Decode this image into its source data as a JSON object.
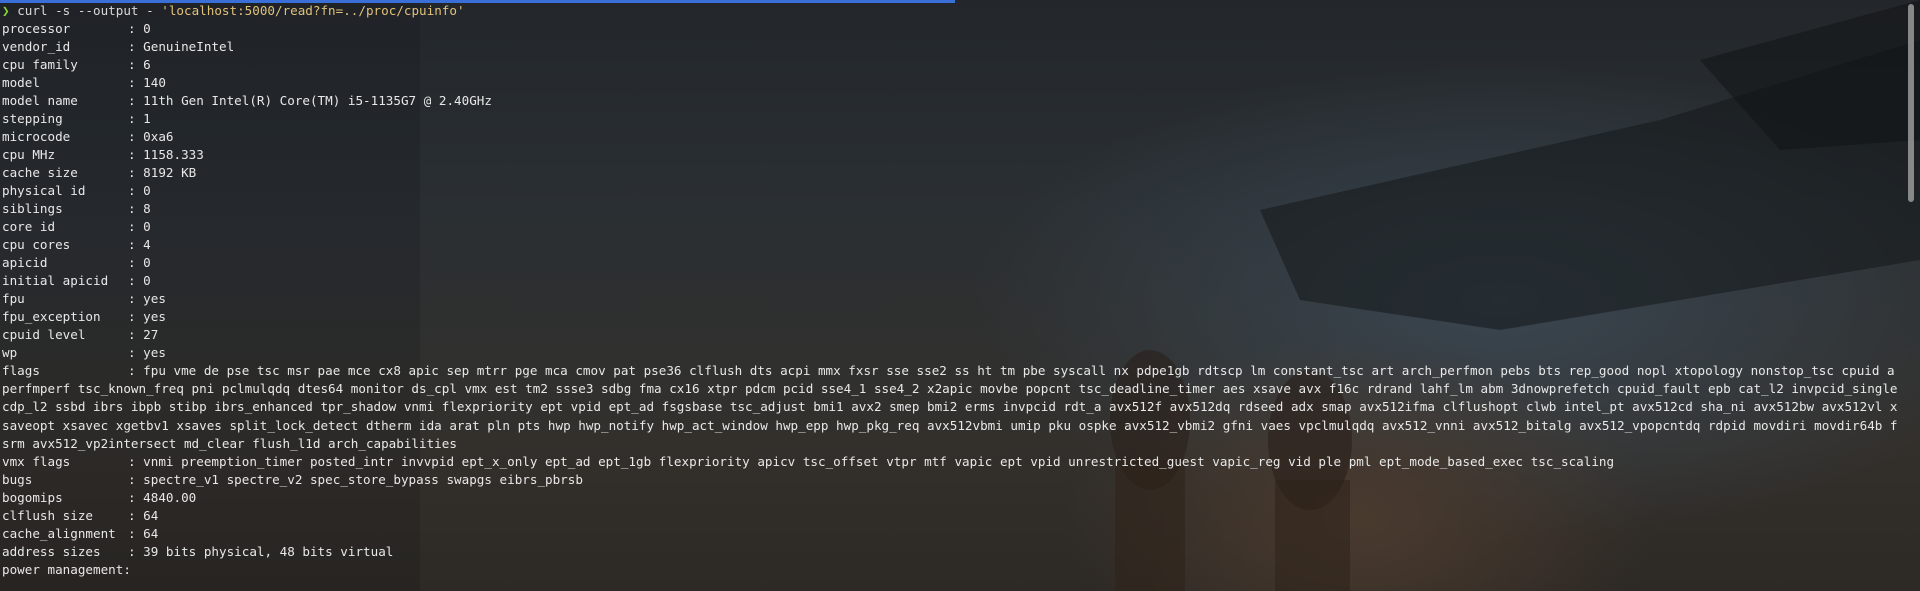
{
  "terminal": {
    "prompt_symbol": "❯",
    "command_prefix": "curl -s --output - ",
    "command_arg": "'localhost:5000/read?fn=../proc/cpuinfo'"
  },
  "cpuinfo": [
    {
      "key": "processor",
      "value": "0"
    },
    {
      "key": "vendor_id",
      "value": "GenuineIntel"
    },
    {
      "key": "cpu family",
      "value": "6"
    },
    {
      "key": "model",
      "value": "140"
    },
    {
      "key": "model name",
      "value": "11th Gen Intel(R) Core(TM) i5-1135G7 @ 2.40GHz"
    },
    {
      "key": "stepping",
      "value": "1"
    },
    {
      "key": "microcode",
      "value": "0xa6"
    },
    {
      "key": "cpu MHz",
      "value": "1158.333"
    },
    {
      "key": "cache size",
      "value": "8192 KB"
    },
    {
      "key": "physical id",
      "value": "0"
    },
    {
      "key": "siblings",
      "value": "8"
    },
    {
      "key": "core id",
      "value": "0"
    },
    {
      "key": "cpu cores",
      "value": "4"
    },
    {
      "key": "apicid",
      "value": "0"
    },
    {
      "key": "initial apicid",
      "value": "0"
    },
    {
      "key": "fpu",
      "value": "yes"
    },
    {
      "key": "fpu_exception",
      "value": "yes"
    },
    {
      "key": "cpuid level",
      "value": "27"
    },
    {
      "key": "wp",
      "value": "yes"
    }
  ],
  "flags": {
    "key": "flags",
    "value": "fpu vme de pse tsc msr pae mce cx8 apic sep mtrr pge mca cmov pat pse36 clflush dts acpi mmx fxsr sse sse2 ss ht tm pbe syscall nx pdpe1gb rdtscp lm constant_tsc art arch_perfmon pebs bts rep_good nopl xtopology nonstop_tsc cpuid aperfmperf tsc_known_freq pni pclmulqdq dtes64 monitor ds_cpl vmx est tm2 ssse3 sdbg fma cx16 xtpr pdcm pcid sse4_1 sse4_2 x2apic movbe popcnt tsc_deadline_timer aes xsave avx f16c rdrand lahf_lm abm 3dnowprefetch cpuid_fault epb cat_l2 invpcid_single cdp_l2 ssbd ibrs ibpb stibp ibrs_enhanced tpr_shadow vnmi flexpriority ept vpid ept_ad fsgsbase tsc_adjust bmi1 avx2 smep bmi2 erms invpcid rdt_a avx512f avx512dq rdseed adx smap avx512ifma clflushopt clwb intel_pt avx512cd sha_ni avx512bw avx512vl xsaveopt xsavec xgetbv1 xsaves split_lock_detect dtherm ida arat pln pts hwp hwp_notify hwp_act_window hwp_epp hwp_pkg_req avx512vbmi umip pku ospke avx512_vbmi2 gfni vaes vpclmulqdq avx512_vnni avx512_bitalg avx512_vpopcntdq rdpid movdiri movdir64b fsrm avx512_vp2intersect md_clear flush_l1d arch_capabilities"
  },
  "cpuinfo_tail": [
    {
      "key": "vmx flags",
      "value": "vnmi preemption_timer posted_intr invvpid ept_x_only ept_ad ept_1gb flexpriority apicv tsc_offset vtpr mtf vapic ept vpid unrestricted_guest vapic_reg vid ple pml ept_mode_based_exec tsc_scaling"
    },
    {
      "key": "bugs",
      "value": "spectre_v1 spectre_v2 spec_store_bypass swapgs eibrs_pbrsb"
    },
    {
      "key": "bogomips",
      "value": "4840.00"
    },
    {
      "key": "clflush size",
      "value": "64"
    },
    {
      "key": "cache_alignment",
      "value": "64"
    },
    {
      "key": "address sizes",
      "value": "39 bits physical, 48 bits virtual"
    }
  ],
  "last_line": {
    "key": "power management",
    "value": ""
  },
  "separator": ": ",
  "colors": {
    "prompt": "#86d936",
    "text": "#e8e8e8",
    "string": "#e0c27a",
    "progress": "#3b6fd8"
  }
}
